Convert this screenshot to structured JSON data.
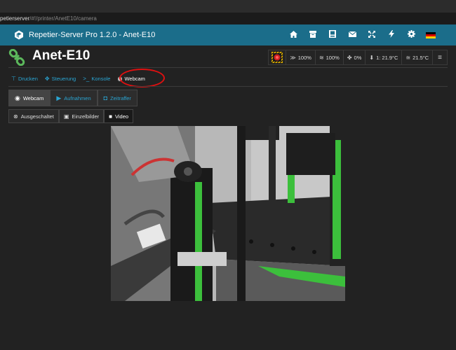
{
  "browser": {
    "url_host": "petierserver",
    "url_path": "/#!/printer/AnetE10/camera"
  },
  "navbar": {
    "title": "Repetier-Server Pro 1.2.0 - Anet-E10",
    "icons": [
      "home-icon",
      "box-icon",
      "film-icon",
      "envelope-icon",
      "expand-icon",
      "bolt-icon",
      "gear-icon",
      "flag-de-icon"
    ]
  },
  "printer": {
    "name": "Anet-E10"
  },
  "status": {
    "speed": "100%",
    "flow": "100%",
    "fan": "0%",
    "extruder_temp": "1: 21.9°C",
    "bed_temp": "21.5°C"
  },
  "tabs": [
    {
      "label": "Drucken",
      "icon": "print-icon"
    },
    {
      "label": "Steuerung",
      "icon": "move-icon"
    },
    {
      "label": "Konsole",
      "icon": "terminal-icon"
    },
    {
      "label": "Webcam",
      "icon": "webcam-icon"
    }
  ],
  "subtabs": [
    {
      "label": "Webcam",
      "icon": "webcam-icon"
    },
    {
      "label": "Aufnahmen",
      "icon": "play-icon"
    },
    {
      "label": "Zeitraffer",
      "icon": "camera-icon"
    }
  ],
  "modes": [
    {
      "label": "Ausgeschaltet",
      "icon": "close-circle-icon"
    },
    {
      "label": "Einzelbilder",
      "icon": "image-icon"
    },
    {
      "label": "Video",
      "icon": "video-icon"
    }
  ],
  "colors": {
    "navbar": "#1b6d8a",
    "accent": "#2aa6d4",
    "background": "#222222",
    "highlight": "#e01010"
  }
}
